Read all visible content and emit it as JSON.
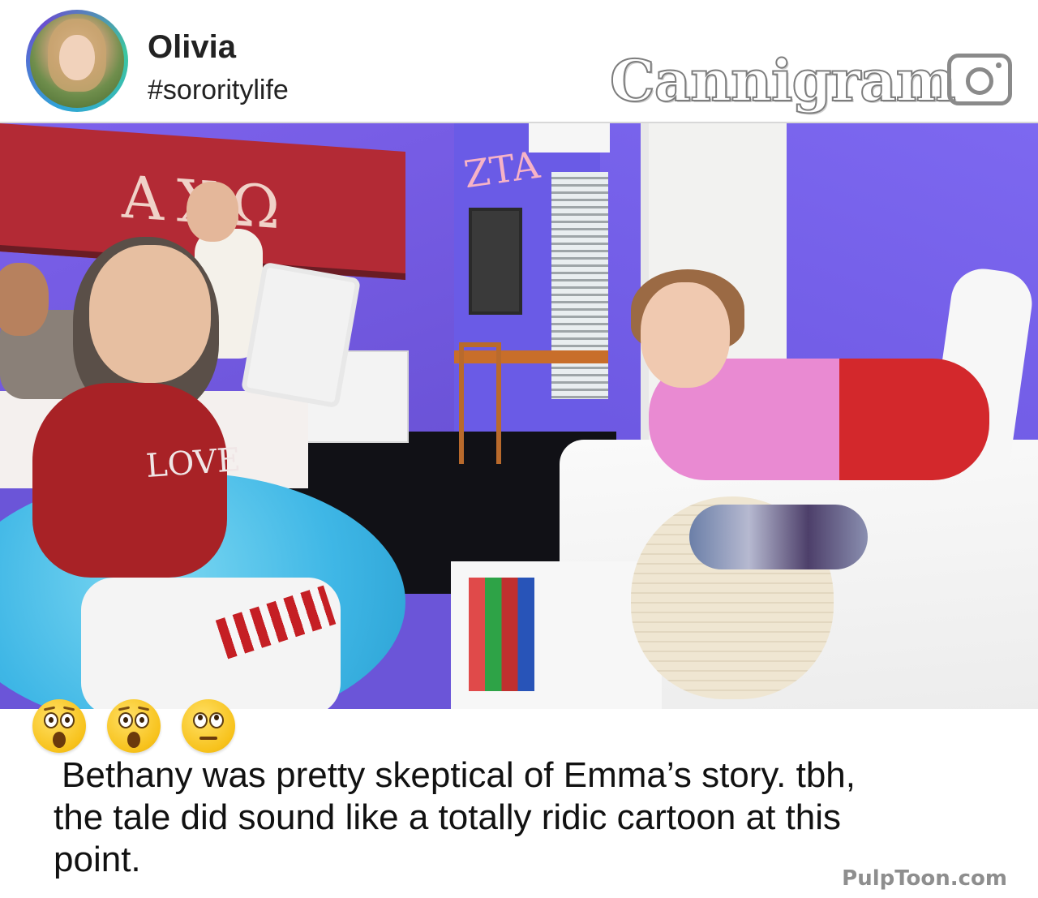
{
  "profile": {
    "username": "Olivia",
    "hashtag": "#sororitylife"
  },
  "brand": {
    "name": "Cannigram",
    "icon": "camera-icon"
  },
  "photo": {
    "banner_text": "AXΩ",
    "sign_text": "ZTA",
    "shirt_text": "LOVE"
  },
  "reactions": [
    {
      "icon": "astonished-face-emoji"
    },
    {
      "icon": "astonished-face-emoji"
    },
    {
      "icon": "face-with-rolling-eyes-emoji"
    }
  ],
  "caption": {
    "lines": [
      "Bethany was pretty skeptical of Emma’s story. tbh,",
      "the tale did sound like a totally ridic cartoon at this",
      "point."
    ]
  },
  "watermark": "PulpToon.com"
}
